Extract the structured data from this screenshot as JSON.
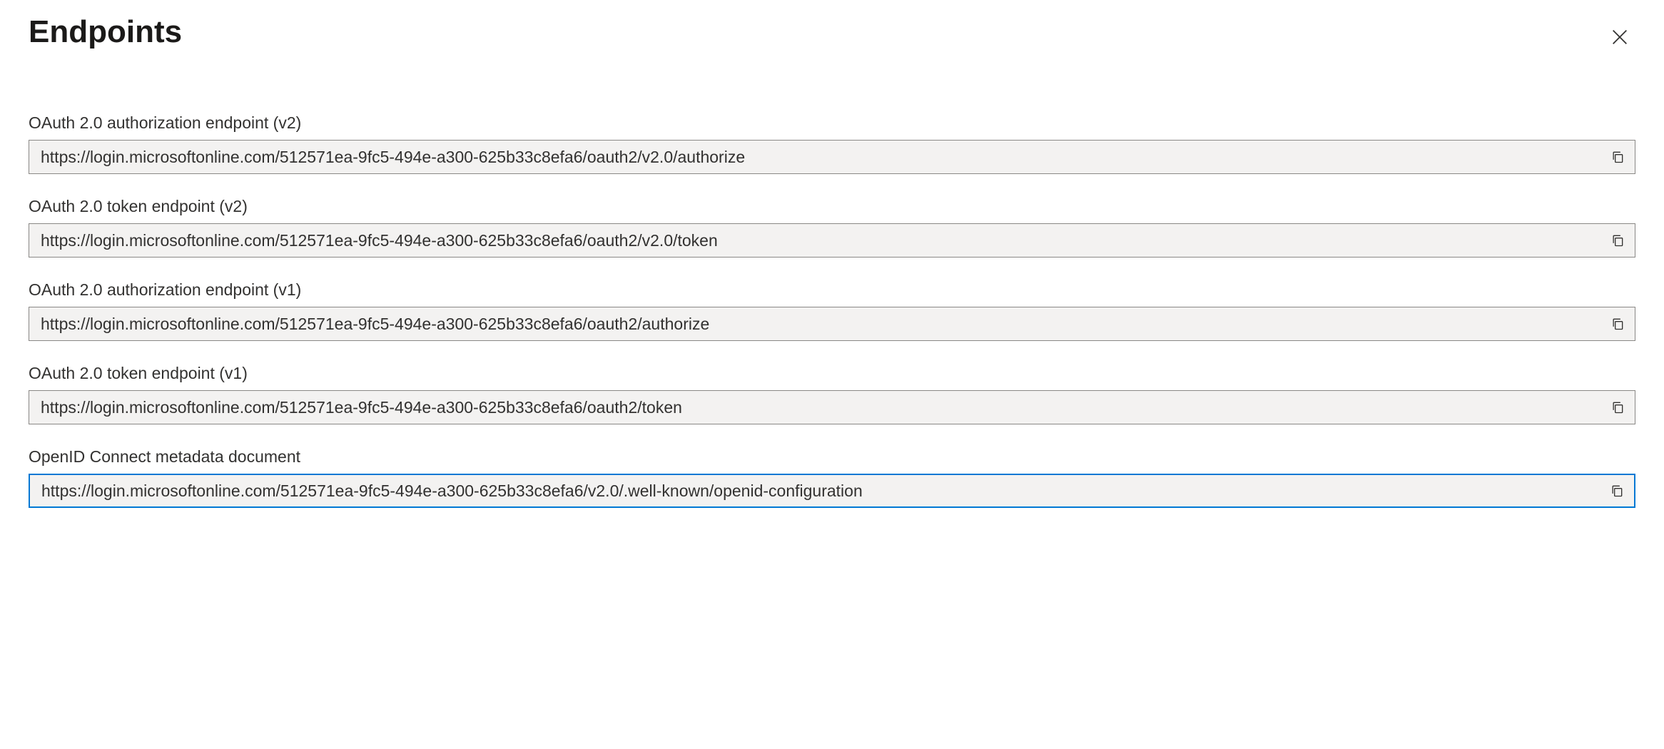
{
  "title": "Endpoints",
  "endpoints": [
    {
      "label": "OAuth 2.0 authorization endpoint (v2)",
      "value": "https://login.microsoftonline.com/512571ea-9fc5-494e-a300-625b33c8efa6/oauth2/v2.0/authorize",
      "focused": false
    },
    {
      "label": "OAuth 2.0 token endpoint (v2)",
      "value": "https://login.microsoftonline.com/512571ea-9fc5-494e-a300-625b33c8efa6/oauth2/v2.0/token",
      "focused": false
    },
    {
      "label": "OAuth 2.0 authorization endpoint (v1)",
      "value": "https://login.microsoftonline.com/512571ea-9fc5-494e-a300-625b33c8efa6/oauth2/authorize",
      "focused": false
    },
    {
      "label": "OAuth 2.0 token endpoint (v1)",
      "value": "https://login.microsoftonline.com/512571ea-9fc5-494e-a300-625b33c8efa6/oauth2/token",
      "focused": false
    },
    {
      "label": "OpenID Connect metadata document",
      "value": "https://login.microsoftonline.com/512571ea-9fc5-494e-a300-625b33c8efa6/v2.0/.well-known/openid-configuration",
      "focused": true
    }
  ]
}
